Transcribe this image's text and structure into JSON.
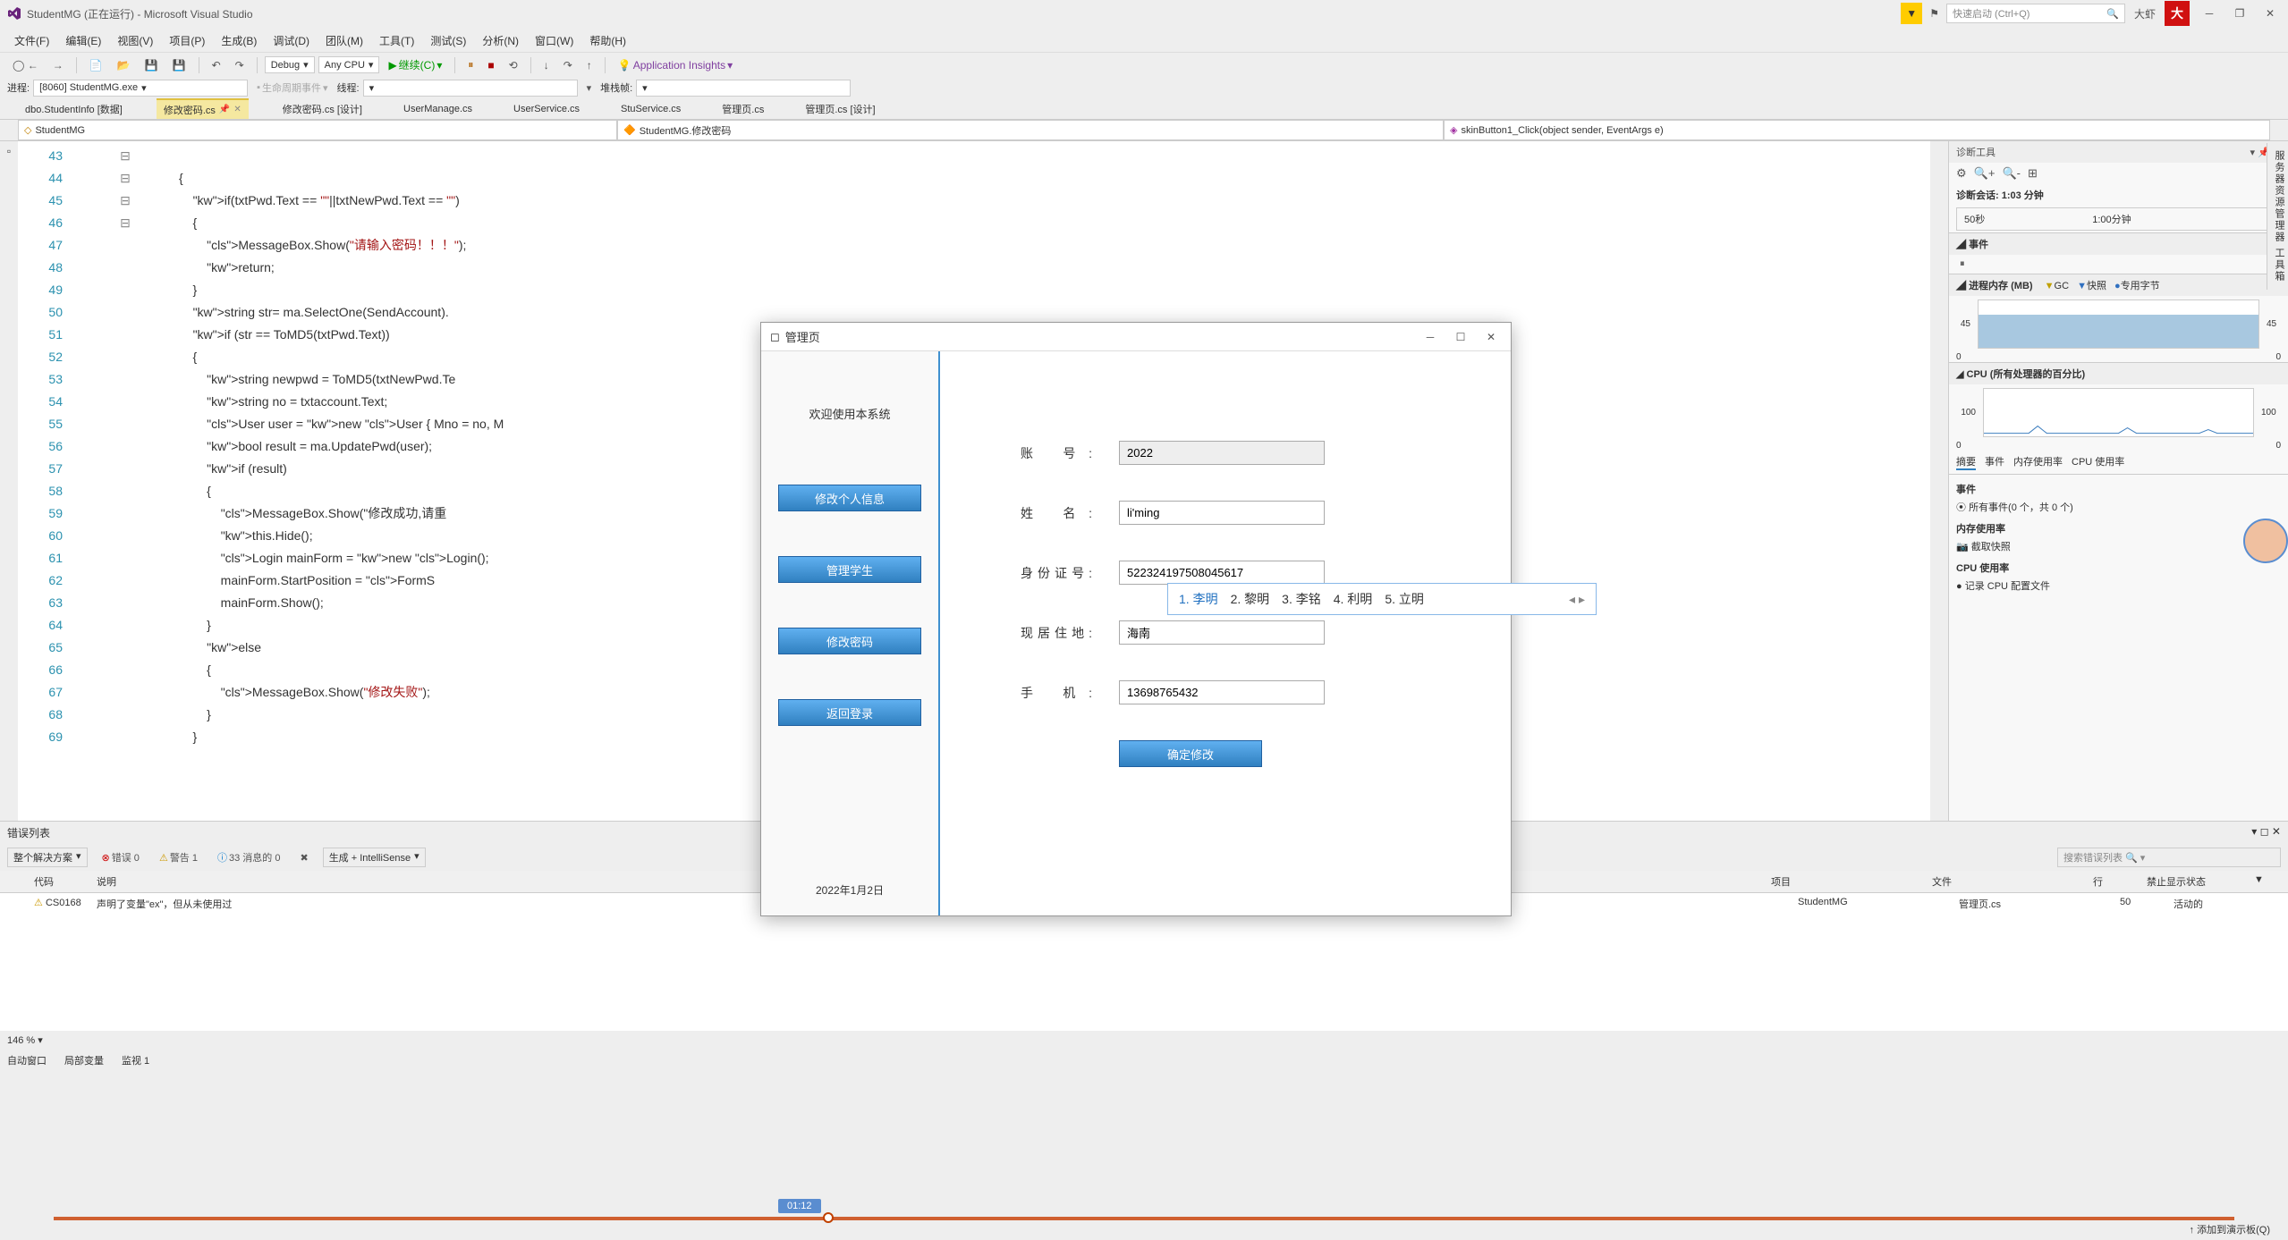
{
  "window": {
    "title": "StudentMG (正在运行) - Microsoft Visual Studio",
    "quickLaunch": "快速启动 (Ctrl+Q)",
    "user": "大虾"
  },
  "menu": [
    "文件(F)",
    "编辑(E)",
    "视图(V)",
    "项目(P)",
    "生成(B)",
    "调试(D)",
    "团队(M)",
    "工具(T)",
    "测试(S)",
    "分析(N)",
    "窗口(W)",
    "帮助(H)"
  ],
  "toolbar": {
    "config": "Debug",
    "platform": "Any CPU",
    "continue": "继续(C)",
    "insights": "Application Insights"
  },
  "toolbar2": {
    "processLabel": "进程:",
    "process": "[8060] StudentMG.exe",
    "lifecycle": "生命周期事件",
    "threadLabel": "线程:",
    "stackFrame": "堆栈帧:"
  },
  "docTabs": [
    {
      "label": "dbo.StudentInfo [数据]",
      "active": false
    },
    {
      "label": "修改密码.cs",
      "active": true,
      "pinned": true
    },
    {
      "label": "修改密码.cs [设计]",
      "active": false
    },
    {
      "label": "UserManage.cs",
      "active": false
    },
    {
      "label": "UserService.cs",
      "active": false
    },
    {
      "label": "StuService.cs",
      "active": false
    },
    {
      "label": "管理页.cs",
      "active": false
    },
    {
      "label": "管理页.cs [设计]",
      "active": false
    }
  ],
  "context": {
    "class": "StudentMG",
    "member": "StudentMG.修改密码",
    "method": "skinButton1_Click(object sender, EventArgs e)"
  },
  "code": {
    "startLine": 43,
    "lines": [
      "",
      "{",
      "    if(txtPwd.Text == \"\"||txtNewPwd.Text == \"\")",
      "    {",
      "        MessageBox.Show(\"请输入密码！！！\");",
      "        return;",
      "    }",
      "    string str= ma.SelectOne(SendAccount).",
      "    if (str == ToMD5(txtPwd.Text))",
      "    {",
      "        string newpwd = ToMD5(txtNewPwd.Te",
      "        string no = txtaccount.Text;",
      "        User user = new User { Mno = no, M",
      "        bool result = ma.UpdatePwd(user);",
      "        if (result)",
      "        {",
      "            MessageBox.Show(\"修改成功,请重",
      "            this.Hide();",
      "            Login mainForm = new Login();",
      "            mainForm.StartPosition = FormS",
      "            mainForm.Show();",
      "        }",
      "        else",
      "        {",
      "            MessageBox.Show(\"修改失败\");",
      "        }",
      "    }"
    ]
  },
  "diag": {
    "title": "诊断工具",
    "session": "诊断会话: 1:03 分钟",
    "t1": "50秒",
    "t2": "1:00分钟",
    "events": "事件",
    "memory": "进程内存 (MB)",
    "gc": "GC",
    "snapshot": "快照",
    "bytes": "专用字节",
    "memMax": "45",
    "memMin": "0",
    "cpu": "CPU (所有处理器的百分比)",
    "cpuMax": "100",
    "cpuMin": "0",
    "tabs": [
      "摘要",
      "事件",
      "内存使用率",
      "CPU 使用率"
    ],
    "eventsSection": "事件",
    "allEvents": "所有事件(0 个，共 0 个)",
    "memSection": "内存使用率",
    "snapshotBtn": "截取快照",
    "cpuSection": "CPU 使用率",
    "recordCpu": "记录 CPU 配置文件"
  },
  "errorList": {
    "title": "错误列表",
    "scope": "整个解决方案",
    "errors": "错误 0",
    "warnings": "警告 1",
    "messages": "33 消息的 0",
    "build": "生成 + IntelliSense",
    "search": "搜索错误列表",
    "cols": {
      "code": "代码",
      "desc": "说明",
      "proj": "项目",
      "file": "文件",
      "line": "行",
      "supp": "禁止显示状态"
    },
    "row": {
      "code": "CS0168",
      "desc": "声明了变量\"ex\"，但从未使用过",
      "proj": "StudentMG",
      "file": "管理页.cs",
      "line": "50",
      "supp": "活动的"
    }
  },
  "zoom": "146 %",
  "bottomTabs": [
    "自动窗口",
    "局部变量",
    "监视 1"
  ],
  "dialog": {
    "title": "管理页",
    "welcome": "欢迎使用本系统",
    "buttons": [
      "修改个人信息",
      "管理学生",
      "修改密码",
      "返回登录"
    ],
    "date": "2022年1月2日",
    "fields": {
      "account": {
        "label": "账 号:",
        "value": "2022"
      },
      "name": {
        "label": "姓 名:",
        "value": "li'ming"
      },
      "idcard": {
        "label": "身份证号:",
        "value": "522324197508045617"
      },
      "address": {
        "label": "现居住地:",
        "value": "海南"
      },
      "phone": {
        "label": "手 机:",
        "value": "13698765432"
      }
    },
    "submit": "确定修改"
  },
  "ime": {
    "candidates": [
      "1. 李明",
      "2. 黎明",
      "3. 李铭",
      "4. 利明",
      "5. 立明"
    ]
  },
  "sideTab": "服务器资源管理器 工具箱",
  "timePill": "01:12",
  "taskbarRight": "添加到演示板(Q)"
}
